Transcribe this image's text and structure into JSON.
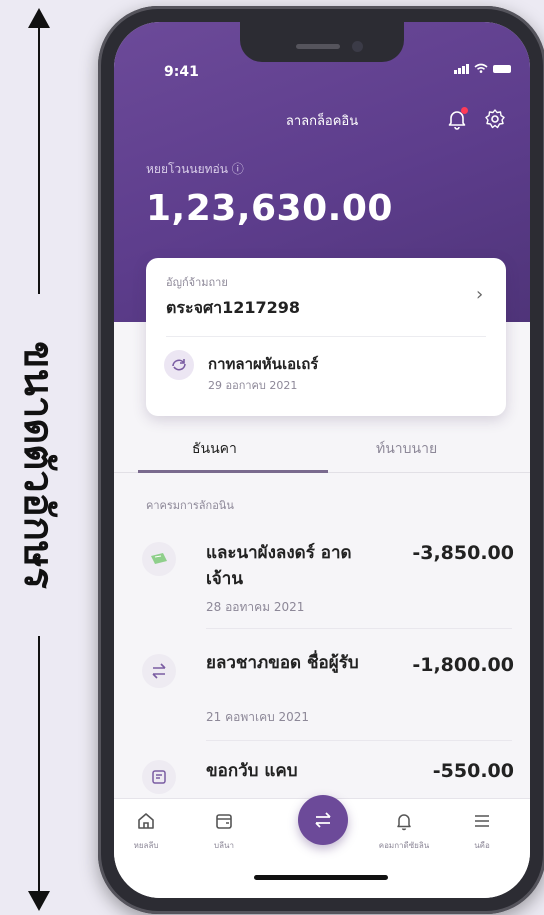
{
  "annotation": {
    "label": "ขนาดตัวอักษร"
  },
  "status_bar": {
    "time": "9:41"
  },
  "header": {
    "title": "ลาลกล็อคอิน"
  },
  "balance": {
    "label": "หยยโวนนยทอ่น ⓘ",
    "amount": "1,23,630.00"
  },
  "account_card": {
    "label": "อัญก์จ้ามถาย",
    "account": "ตระจศา1217298",
    "transfer_name": "กาทลาผหันเอเถร์",
    "transfer_date": "29 ออกาคบ 2021"
  },
  "tabs": [
    {
      "label": "ธันนคา"
    },
    {
      "label": "ท์นาบนาย"
    }
  ],
  "section_title": "คาครมการลักอนิน",
  "transactions": [
    {
      "name": "และนาผังลงดร์ อาดเจ้าน",
      "date": "28 ออทาคม 2021",
      "amount": "-3,850.00"
    },
    {
      "name": "ยลวชาภขอด ชื่อผู้รับ",
      "date": "21 คอพาเคบ 2021",
      "amount": "-1,800.00"
    },
    {
      "name": "ขอกวับ แคบ",
      "date": "",
      "amount": "-550.00"
    }
  ],
  "bottom_nav": [
    {
      "label": "หยลลีบ"
    },
    {
      "label": "บลีนา"
    },
    {
      "label": ""
    },
    {
      "label": "คอมกาดีซัยลิน"
    },
    {
      "label": "นคือ"
    }
  ]
}
